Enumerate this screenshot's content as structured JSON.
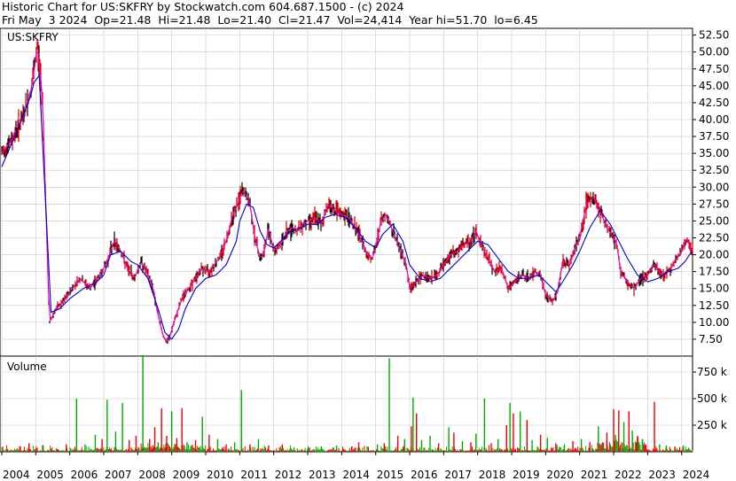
{
  "header": {
    "line1": "Historic Chart for US:SKFRY by Stockwatch.com 604.687.1500 - (c) 2024",
    "line2": "Fri May  3 2024  Op=21.48  Hi=21.48  Lo=21.40  Cl=21.47  Vol=24,414  Year hi=51.70  lo=6.45"
  },
  "chart_data": [
    {
      "type": "line",
      "title": "US:SKFRY",
      "ylim": [
        5.0,
        53.5
      ],
      "y_tick_labels": [
        "7.50",
        "10.00",
        "12.50",
        "15.00",
        "17.50",
        "20.00",
        "22.50",
        "25.00",
        "27.50",
        "30.00",
        "32.50",
        "35.00",
        "37.50",
        "40.00",
        "42.50",
        "45.00",
        "47.50",
        "50.00",
        "52.50"
      ],
      "colors": {
        "price": "#cc0000",
        "price_alt": "#000000",
        "moving_average_long": "#0000cc",
        "moving_average_short": "#ff00aa"
      },
      "series": [
        {
          "key": "price",
          "x": [
            2004.0,
            2004.3,
            2004.6,
            2004.85,
            2004.93,
            2005.05,
            2005.2,
            2005.4,
            2005.6,
            2005.8,
            2006.0,
            2006.3,
            2006.6,
            2006.9,
            2007.1,
            2007.3,
            2007.5,
            2007.7,
            2007.9,
            2008.1,
            2008.3,
            2008.45,
            2008.6,
            2008.75,
            2008.85,
            2008.95,
            2009.1,
            2009.3,
            2009.5,
            2009.7,
            2009.9,
            2010.1,
            2010.4,
            2010.6,
            2010.8,
            2010.95,
            2011.0,
            2011.1,
            2011.3,
            2011.45,
            2011.6,
            2011.7,
            2011.85,
            2012.0,
            2012.2,
            2012.4,
            2012.55,
            2012.7,
            2012.85,
            2013.0,
            2013.2,
            2013.4,
            2013.6,
            2013.8,
            2014.0,
            2014.2,
            2014.4,
            2014.6,
            2014.75,
            2014.9,
            2015.0,
            2015.15,
            2015.3,
            2015.5,
            2015.7,
            2015.9,
            2016.0,
            2016.2,
            2016.4,
            2016.6,
            2016.8,
            2017.0,
            2017.2,
            2017.4,
            2017.6,
            2017.8,
            2017.95,
            2018.1,
            2018.3,
            2018.5,
            2018.7,
            2018.9,
            2019.1,
            2019.3,
            2019.5,
            2019.7,
            2019.85,
            2020.0,
            2020.2,
            2020.35,
            2020.5,
            2020.7,
            2020.9,
            2021.0,
            2021.1,
            2021.2,
            2021.4,
            2021.6,
            2021.8,
            2022.0,
            2022.1,
            2022.2,
            2022.4,
            2022.6,
            2022.8,
            2023.0,
            2023.2,
            2023.4,
            2023.6,
            2023.8,
            2024.0,
            2024.15,
            2024.3
          ],
          "values": [
            35.0,
            37.0,
            40.0,
            44.0,
            46.5,
            51.0,
            43.0,
            10.0,
            12.0,
            13.0,
            14.5,
            16.5,
            15.0,
            17.0,
            19.0,
            22.0,
            20.5,
            18.0,
            16.5,
            19.0,
            17.0,
            15.0,
            11.0,
            8.0,
            7.0,
            8.0,
            10.5,
            13.5,
            15.0,
            16.5,
            18.0,
            17.5,
            19.5,
            22.0,
            26.0,
            27.5,
            28.5,
            29.5,
            27.5,
            22.5,
            19.5,
            20.0,
            24.0,
            20.5,
            21.5,
            23.5,
            24.0,
            23.5,
            24.5,
            25.0,
            25.5,
            24.5,
            27.5,
            26.5,
            26.0,
            25.5,
            24.0,
            22.0,
            20.0,
            19.5,
            21.0,
            25.0,
            26.0,
            23.5,
            21.0,
            18.5,
            15.0,
            16.0,
            17.0,
            16.5,
            17.0,
            18.5,
            20.0,
            20.5,
            21.5,
            22.0,
            23.5,
            21.5,
            19.5,
            17.5,
            18.0,
            15.0,
            16.0,
            17.0,
            16.5,
            17.5,
            17.0,
            14.0,
            13.0,
            14.5,
            19.0,
            18.5,
            21.5,
            22.5,
            25.0,
            27.5,
            28.5,
            26.5,
            24.0,
            22.5,
            21.5,
            17.5,
            16.0,
            15.0,
            16.5,
            17.0,
            18.5,
            17.0,
            17.5,
            19.0,
            20.5,
            22.5,
            20.5
          ]
        },
        {
          "key": "moving_average_long",
          "x": [
            2004.0,
            2004.5,
            2004.85,
            2004.95,
            2005.1,
            2005.45,
            2005.7,
            2006.0,
            2006.4,
            2006.8,
            2007.0,
            2007.2,
            2007.5,
            2007.8,
            2008.0,
            2008.3,
            2008.6,
            2008.8,
            2009.0,
            2009.2,
            2009.4,
            2009.7,
            2010.0,
            2010.3,
            2010.6,
            2010.9,
            2011.0,
            2011.2,
            2011.4,
            2011.6,
            2011.8,
            2012.0,
            2012.2,
            2012.5,
            2012.8,
            2013.0,
            2013.3,
            2013.5,
            2013.8,
            2014.1,
            2014.4,
            2014.7,
            2015.0,
            2015.2,
            2015.5,
            2015.8,
            2016.0,
            2016.3,
            2016.6,
            2016.9,
            2017.2,
            2017.5,
            2017.8,
            2018.0,
            2018.3,
            2018.6,
            2018.9,
            2019.2,
            2019.5,
            2019.8,
            2020.0,
            2020.3,
            2020.5,
            2020.8,
            2021.0,
            2021.3,
            2021.6,
            2021.9,
            2022.1,
            2022.4,
            2022.7,
            2023.0,
            2023.3,
            2023.6,
            2023.9,
            2024.1,
            2024.3
          ],
          "values": [
            33.0,
            39.0,
            43.5,
            45.5,
            46.5,
            11.5,
            12.0,
            13.5,
            15.0,
            16.0,
            17.0,
            20.0,
            20.5,
            19.0,
            18.5,
            16.5,
            12.0,
            8.5,
            7.5,
            9.0,
            12.0,
            15.0,
            16.5,
            17.0,
            18.5,
            22.0,
            25.0,
            27.5,
            27.0,
            23.5,
            21.5,
            21.0,
            22.0,
            23.5,
            24.0,
            24.5,
            24.5,
            25.5,
            26.0,
            25.5,
            24.0,
            22.0,
            21.0,
            23.0,
            24.5,
            22.0,
            18.5,
            16.5,
            16.0,
            16.5,
            18.0,
            19.5,
            21.0,
            22.0,
            21.5,
            19.5,
            17.5,
            16.5,
            16.5,
            17.0,
            16.0,
            14.5,
            16.0,
            18.5,
            20.5,
            24.0,
            26.5,
            24.5,
            22.5,
            19.5,
            17.0,
            16.0,
            16.5,
            17.5,
            18.0,
            19.0,
            20.5
          ]
        }
      ]
    },
    {
      "type": "bar",
      "title": "Volume",
      "ylim": [
        0,
        900000
      ],
      "y_tick_labels": [
        "250 k",
        "500 k",
        "750 k"
      ],
      "colors": {
        "up": "#00aa00",
        "down": "#ee0000"
      },
      "spikes": [
        {
          "x": 2004.15,
          "value": 20000,
          "dir": "up"
        },
        {
          "x": 2004.8,
          "value": 80000,
          "dir": "down"
        },
        {
          "x": 2005.2,
          "value": 60000,
          "dir": "up"
        },
        {
          "x": 2005.65,
          "value": 25000,
          "dir": "down"
        },
        {
          "x": 2005.9,
          "value": 70000,
          "dir": "down"
        },
        {
          "x": 2006.2,
          "value": 500000,
          "dir": "up"
        },
        {
          "x": 2006.45,
          "value": 70000,
          "dir": "up"
        },
        {
          "x": 2006.75,
          "value": 160000,
          "dir": "up"
        },
        {
          "x": 2006.95,
          "value": 120000,
          "dir": "down"
        },
        {
          "x": 2007.1,
          "value": 490000,
          "dir": "up"
        },
        {
          "x": 2007.35,
          "value": 190000,
          "dir": "up"
        },
        {
          "x": 2007.55,
          "value": 460000,
          "dir": "up"
        },
        {
          "x": 2007.75,
          "value": 110000,
          "dir": "down"
        },
        {
          "x": 2007.95,
          "value": 150000,
          "dir": "down"
        },
        {
          "x": 2008.15,
          "value": 910000,
          "dir": "up"
        },
        {
          "x": 2008.35,
          "value": 120000,
          "dir": "down"
        },
        {
          "x": 2008.5,
          "value": 230000,
          "dir": "down"
        },
        {
          "x": 2008.6,
          "value": 90000,
          "dir": "up"
        },
        {
          "x": 2008.7,
          "value": 410000,
          "dir": "down"
        },
        {
          "x": 2008.85,
          "value": 150000,
          "dir": "down"
        },
        {
          "x": 2009.0,
          "value": 380000,
          "dir": "up"
        },
        {
          "x": 2009.15,
          "value": 130000,
          "dir": "down"
        },
        {
          "x": 2009.3,
          "value": 410000,
          "dir": "down"
        },
        {
          "x": 2009.45,
          "value": 90000,
          "dir": "up"
        },
        {
          "x": 2009.7,
          "value": 110000,
          "dir": "down"
        },
        {
          "x": 2009.9,
          "value": 330000,
          "dir": "up"
        },
        {
          "x": 2010.1,
          "value": 160000,
          "dir": "down"
        },
        {
          "x": 2010.35,
          "value": 120000,
          "dir": "up"
        },
        {
          "x": 2010.6,
          "value": 70000,
          "dir": "down"
        },
        {
          "x": 2010.85,
          "value": 90000,
          "dir": "up"
        },
        {
          "x": 2011.05,
          "value": 580000,
          "dir": "up"
        },
        {
          "x": 2011.3,
          "value": 70000,
          "dir": "down"
        },
        {
          "x": 2011.55,
          "value": 120000,
          "dir": "up"
        },
        {
          "x": 2011.85,
          "value": 60000,
          "dir": "down"
        },
        {
          "x": 2012.25,
          "value": 70000,
          "dir": "down"
        },
        {
          "x": 2012.6,
          "value": 40000,
          "dir": "up"
        },
        {
          "x": 2013.05,
          "value": 40000,
          "dir": "down"
        },
        {
          "x": 2013.4,
          "value": 50000,
          "dir": "up"
        },
        {
          "x": 2013.85,
          "value": 60000,
          "dir": "up"
        },
        {
          "x": 2014.3,
          "value": 50000,
          "dir": "down"
        },
        {
          "x": 2014.5,
          "value": 90000,
          "dir": "down"
        },
        {
          "x": 2014.75,
          "value": 50000,
          "dir": "up"
        },
        {
          "x": 2015.05,
          "value": 70000,
          "dir": "up"
        },
        {
          "x": 2015.25,
          "value": 80000,
          "dir": "down"
        },
        {
          "x": 2015.4,
          "value": 880000,
          "dir": "up"
        },
        {
          "x": 2015.65,
          "value": 150000,
          "dir": "down"
        },
        {
          "x": 2015.85,
          "value": 120000,
          "dir": "up"
        },
        {
          "x": 2016.05,
          "value": 240000,
          "dir": "down"
        },
        {
          "x": 2016.1,
          "value": 510000,
          "dir": "up"
        },
        {
          "x": 2016.2,
          "value": 360000,
          "dir": "down"
        },
        {
          "x": 2016.35,
          "value": 110000,
          "dir": "up"
        },
        {
          "x": 2016.6,
          "value": 150000,
          "dir": "up"
        },
        {
          "x": 2016.85,
          "value": 80000,
          "dir": "down"
        },
        {
          "x": 2017.15,
          "value": 230000,
          "dir": "up"
        },
        {
          "x": 2017.3,
          "value": 180000,
          "dir": "down"
        },
        {
          "x": 2017.55,
          "value": 100000,
          "dir": "up"
        },
        {
          "x": 2017.8,
          "value": 90000,
          "dir": "down"
        },
        {
          "x": 2017.95,
          "value": 170000,
          "dir": "up"
        },
        {
          "x": 2018.2,
          "value": 500000,
          "dir": "up"
        },
        {
          "x": 2018.4,
          "value": 80000,
          "dir": "down"
        },
        {
          "x": 2018.6,
          "value": 120000,
          "dir": "up"
        },
        {
          "x": 2018.85,
          "value": 250000,
          "dir": "down"
        },
        {
          "x": 2018.95,
          "value": 460000,
          "dir": "up"
        },
        {
          "x": 2019.05,
          "value": 360000,
          "dir": "down"
        },
        {
          "x": 2019.25,
          "value": 380000,
          "dir": "up"
        },
        {
          "x": 2019.45,
          "value": 300000,
          "dir": "down"
        },
        {
          "x": 2019.6,
          "value": 110000,
          "dir": "up"
        },
        {
          "x": 2019.85,
          "value": 160000,
          "dir": "down"
        },
        {
          "x": 2020.05,
          "value": 130000,
          "dir": "up"
        },
        {
          "x": 2020.3,
          "value": 80000,
          "dir": "down"
        },
        {
          "x": 2020.55,
          "value": 70000,
          "dir": "up"
        },
        {
          "x": 2020.8,
          "value": 100000,
          "dir": "down"
        },
        {
          "x": 2021.05,
          "value": 120000,
          "dir": "up"
        },
        {
          "x": 2021.3,
          "value": 90000,
          "dir": "down"
        },
        {
          "x": 2021.55,
          "value": 240000,
          "dir": "up"
        },
        {
          "x": 2021.8,
          "value": 180000,
          "dir": "down"
        },
        {
          "x": 2022.0,
          "value": 400000,
          "dir": "down"
        },
        {
          "x": 2022.05,
          "value": 160000,
          "dir": "up"
        },
        {
          "x": 2022.15,
          "value": 390000,
          "dir": "down"
        },
        {
          "x": 2022.3,
          "value": 280000,
          "dir": "up"
        },
        {
          "x": 2022.45,
          "value": 380000,
          "dir": "down"
        },
        {
          "x": 2022.55,
          "value": 200000,
          "dir": "up"
        },
        {
          "x": 2022.7,
          "value": 150000,
          "dir": "down"
        },
        {
          "x": 2022.85,
          "value": 120000,
          "dir": "up"
        },
        {
          "x": 2023.2,
          "value": 470000,
          "dir": "down"
        },
        {
          "x": 2023.35,
          "value": 70000,
          "dir": "up"
        },
        {
          "x": 2023.55,
          "value": 60000,
          "dir": "up"
        },
        {
          "x": 2023.8,
          "value": 50000,
          "dir": "down"
        },
        {
          "x": 2024.05,
          "value": 60000,
          "dir": "up"
        }
      ]
    }
  ],
  "x_axis": {
    "labels": [
      "2004",
      "2005",
      "2006",
      "2007",
      "2008",
      "2009",
      "2010",
      "2011",
      "2012",
      "2013",
      "2014",
      "2015",
      "2016",
      "2017",
      "2018",
      "2019",
      "2020",
      "2021",
      "2022",
      "2023",
      "2024"
    ]
  }
}
